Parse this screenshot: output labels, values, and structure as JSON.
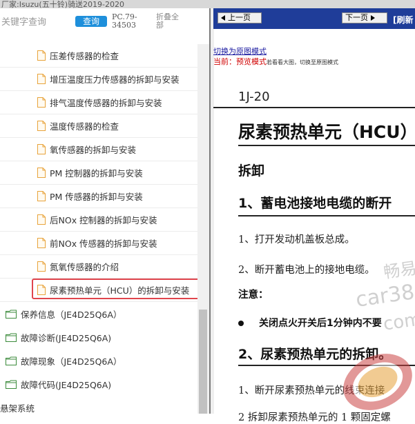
{
  "window": {
    "title": "厂家:Isuzu(五十铃)骑送2019-2020"
  },
  "left_pane": {
    "search_placeholder": "关键字查询",
    "query_button": "查询",
    "model": "PC.79-34503",
    "collapse_all": "折叠全部",
    "children": [
      "压差传感器的检查",
      "增压温度压力传感器的拆卸与安装",
      "排气温度传感器的拆卸与安装",
      "温度传感器的检查",
      "氧传感器的拆卸与安装",
      "PM 控制器的拆卸与安装",
      "PM 传感器的拆卸与安装",
      "后NOx 控制器的拆卸与安装",
      "前NOx 传感器的拆卸与安装",
      "氮氧传感器的介绍",
      "尿素预热单元（HCU）的拆卸与安装"
    ],
    "selected_index": 10,
    "folders": [
      "保养信息（JE4D25Q6A）",
      "故障诊断(JE4D25Q6A)",
      "故障现象（JE4D25Q6A）",
      "故障代码(JE4D25Q6A)"
    ],
    "bottom_item": "悬架系统"
  },
  "right_pane": {
    "prev_button": "上一页",
    "next_button": "下一页",
    "refresh": "[刷新",
    "switch_link": "切换为原图模式",
    "mode_prefix": "当前：",
    "mode_name": "预览模式",
    "mode_hint": "若看看大图，切换至原图模式",
    "page_number": "1J-20",
    "title": "尿素预热单元（HCU）",
    "section": "拆卸",
    "step1_head": "1、蓄电池接地电缆的断开",
    "step1_lines": [
      "1、打开发动机盖板总成。",
      "2、断开蓄电池上的接地电缆。"
    ],
    "note_head": "注意：",
    "bullet": "关闭点火开关后1分钟内不要",
    "step2_head": "2、尿素预热单元的拆卸。",
    "step2_lines": [
      "1、断开尿素预热单元的线束连接",
      "2 拆卸尿素预热单元的 1 颗固定螺"
    ],
    "watermark_text": [
      "畅易",
      "car38",
      "com"
    ]
  },
  "colors": {
    "nav_bar": "#1f3d99",
    "query_button": "#1e8fdb",
    "selected_border": "#e0444c",
    "mode_red": "#d00000",
    "folder_green": "#3a8a3a",
    "file_orange": "#e8a33a"
  }
}
